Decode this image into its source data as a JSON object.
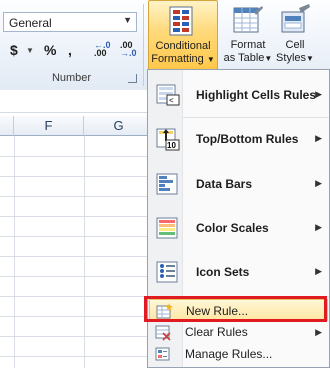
{
  "ribbon": {
    "number_group": {
      "format_value": "General",
      "currency_symbol": "$",
      "percent_symbol": "%",
      "comma_symbol": ",",
      "increase_decimal": {
        "top": "←.0",
        "bottom": ".00"
      },
      "decrease_decimal": {
        "top": ".00",
        "bottom": "→.0"
      },
      "label": "Number"
    },
    "conditional_formatting": {
      "line1": "Conditional",
      "line2": "Formatting"
    },
    "format_as_table": {
      "line1": "Format",
      "line2": "as Table"
    },
    "cell_styles": {
      "line1": "Cell",
      "line2": "Styles"
    }
  },
  "sheet": {
    "columns": [
      "F",
      "G"
    ]
  },
  "menu": {
    "items": [
      {
        "label": "Highlight Cells Rules",
        "icon": "highlight-cells-icon",
        "submenu": true
      },
      {
        "label": "Top/Bottom Rules",
        "icon": "top-bottom-icon",
        "submenu": true
      },
      {
        "label": "Data Bars",
        "icon": "data-bars-icon",
        "submenu": true
      },
      {
        "label": "Color Scales",
        "icon": "color-scales-icon",
        "submenu": true
      },
      {
        "label": "Icon Sets",
        "icon": "icon-sets-icon",
        "submenu": true
      },
      {
        "label": "New Rule...",
        "icon": "new-rule-icon",
        "submenu": false
      },
      {
        "label": "Clear Rules",
        "icon": "clear-rules-icon",
        "submenu": true
      },
      {
        "label": "Manage Rules...",
        "icon": "manage-rules-icon",
        "submenu": false
      }
    ]
  },
  "colors": {
    "highlight": "#ffe7a2",
    "annotation_box": "#e11b22",
    "accent": "#2b5fb4"
  }
}
